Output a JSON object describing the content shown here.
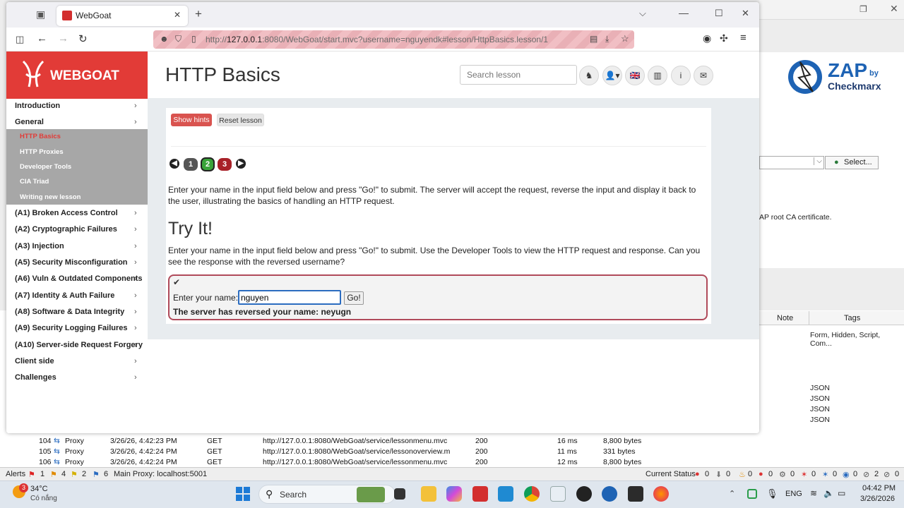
{
  "browser": {
    "tab_title": "WebGoat",
    "url_prefix": "http://",
    "url_host": "127.0.0.1",
    "url_rest": ":8080/WebGoat/start.mvc?username=nguyendk#lesson/HttpBasics.lesson/1"
  },
  "webgoat": {
    "logo_text": "WEBGOAT",
    "page_title": "HTTP Basics",
    "search_placeholder": "Search lesson",
    "show_hints": "Show hints",
    "reset_lesson": "Reset lesson",
    "pages": [
      "1",
      "2",
      "3"
    ],
    "intro_text": "Enter your name in the input field below and press \"Go!\" to submit. The server will accept the request, reverse the input and display it back to the user, illustrating the basics of handling an HTTP request.",
    "try_it": "Try It!",
    "try_text": "Enter your name in the input field below and press \"Go!\" to submit. Use the Developer Tools to view the HTTP request and response. Can you see the response with the reversed username?",
    "name_label": "Enter your name:",
    "name_value": "nguyen",
    "go_button": "Go!",
    "result": "The server has reversed your name: neyugn"
  },
  "sidebar": {
    "items": [
      {
        "label": "Introduction"
      },
      {
        "label": "General"
      },
      {
        "label": "(A1) Broken Access Control"
      },
      {
        "label": "(A2) Cryptographic Failures"
      },
      {
        "label": "(A3) Injection"
      },
      {
        "label": "(A5) Security Misconfiguration"
      },
      {
        "label": "(A6) Vuln & Outdated Components"
      },
      {
        "label": "(A7) Identity & Auth Failure"
      },
      {
        "label": "(A8) Software & Data Integrity"
      },
      {
        "label": "(A9) Security Logging Failures"
      },
      {
        "label": "(A10) Server-side Request Forgery"
      },
      {
        "label": "Client side"
      },
      {
        "label": "Challenges"
      }
    ],
    "sub_items": [
      {
        "label": "HTTP Basics"
      },
      {
        "label": "HTTP Proxies"
      },
      {
        "label": "Developer Tools"
      },
      {
        "label": "CIA Triad"
      },
      {
        "label": "Writing new lesson"
      }
    ]
  },
  "zap": {
    "logo_main": "ZAP",
    "logo_by": "by",
    "logo_brand": "Checkmarx",
    "select_button": "Select...",
    "ca_text": "AP root CA certificate.",
    "col_note": "Note",
    "col_tags": "Tags",
    "tags": [
      "JSON",
      "Form, Hidden, Script, Com...",
      "JSON",
      "JSON",
      "JSON",
      "JSON"
    ],
    "rows": [
      {
        "id": "104",
        "source": "Proxy",
        "time": "3/26/26, 4:42:23 PM",
        "method": "GET",
        "url": "http://127.0.0.1:8080/WebGoat/service/lessonmenu.mvc",
        "code": "200",
        "rtt": "16 ms",
        "size": "8,800 bytes"
      },
      {
        "id": "105",
        "source": "Proxy",
        "time": "3/26/26, 4:42:24 PM",
        "method": "GET",
        "url": "http://127.0.0.1:8080/WebGoat/service/lessonoverview.m",
        "code": "200",
        "rtt": "11 ms",
        "size": "331 bytes"
      },
      {
        "id": "106",
        "source": "Proxy",
        "time": "3/26/26, 4:42:24 PM",
        "method": "GET",
        "url": "http://127.0.0.1:8080/WebGoat/service/lessonmenu.mvc",
        "code": "200",
        "rtt": "12 ms",
        "size": "8,800 bytes"
      }
    ],
    "status": {
      "alerts": "Alerts",
      "a_high": "1",
      "a_med": "4",
      "a_low": "2",
      "a_info": "6",
      "proxy": "Main Proxy: localhost:5001",
      "current": "Current Status",
      "counts": [
        "0",
        "0",
        "0",
        "0",
        "0",
        "0",
        "0",
        "0",
        "2",
        "0"
      ]
    }
  },
  "taskbar": {
    "temp": "34°C",
    "weather": "Có nắng",
    "weather_badge": "3",
    "search": "Search",
    "lang": "ENG",
    "time": "04:42 PM",
    "date": "3/26/2026"
  }
}
